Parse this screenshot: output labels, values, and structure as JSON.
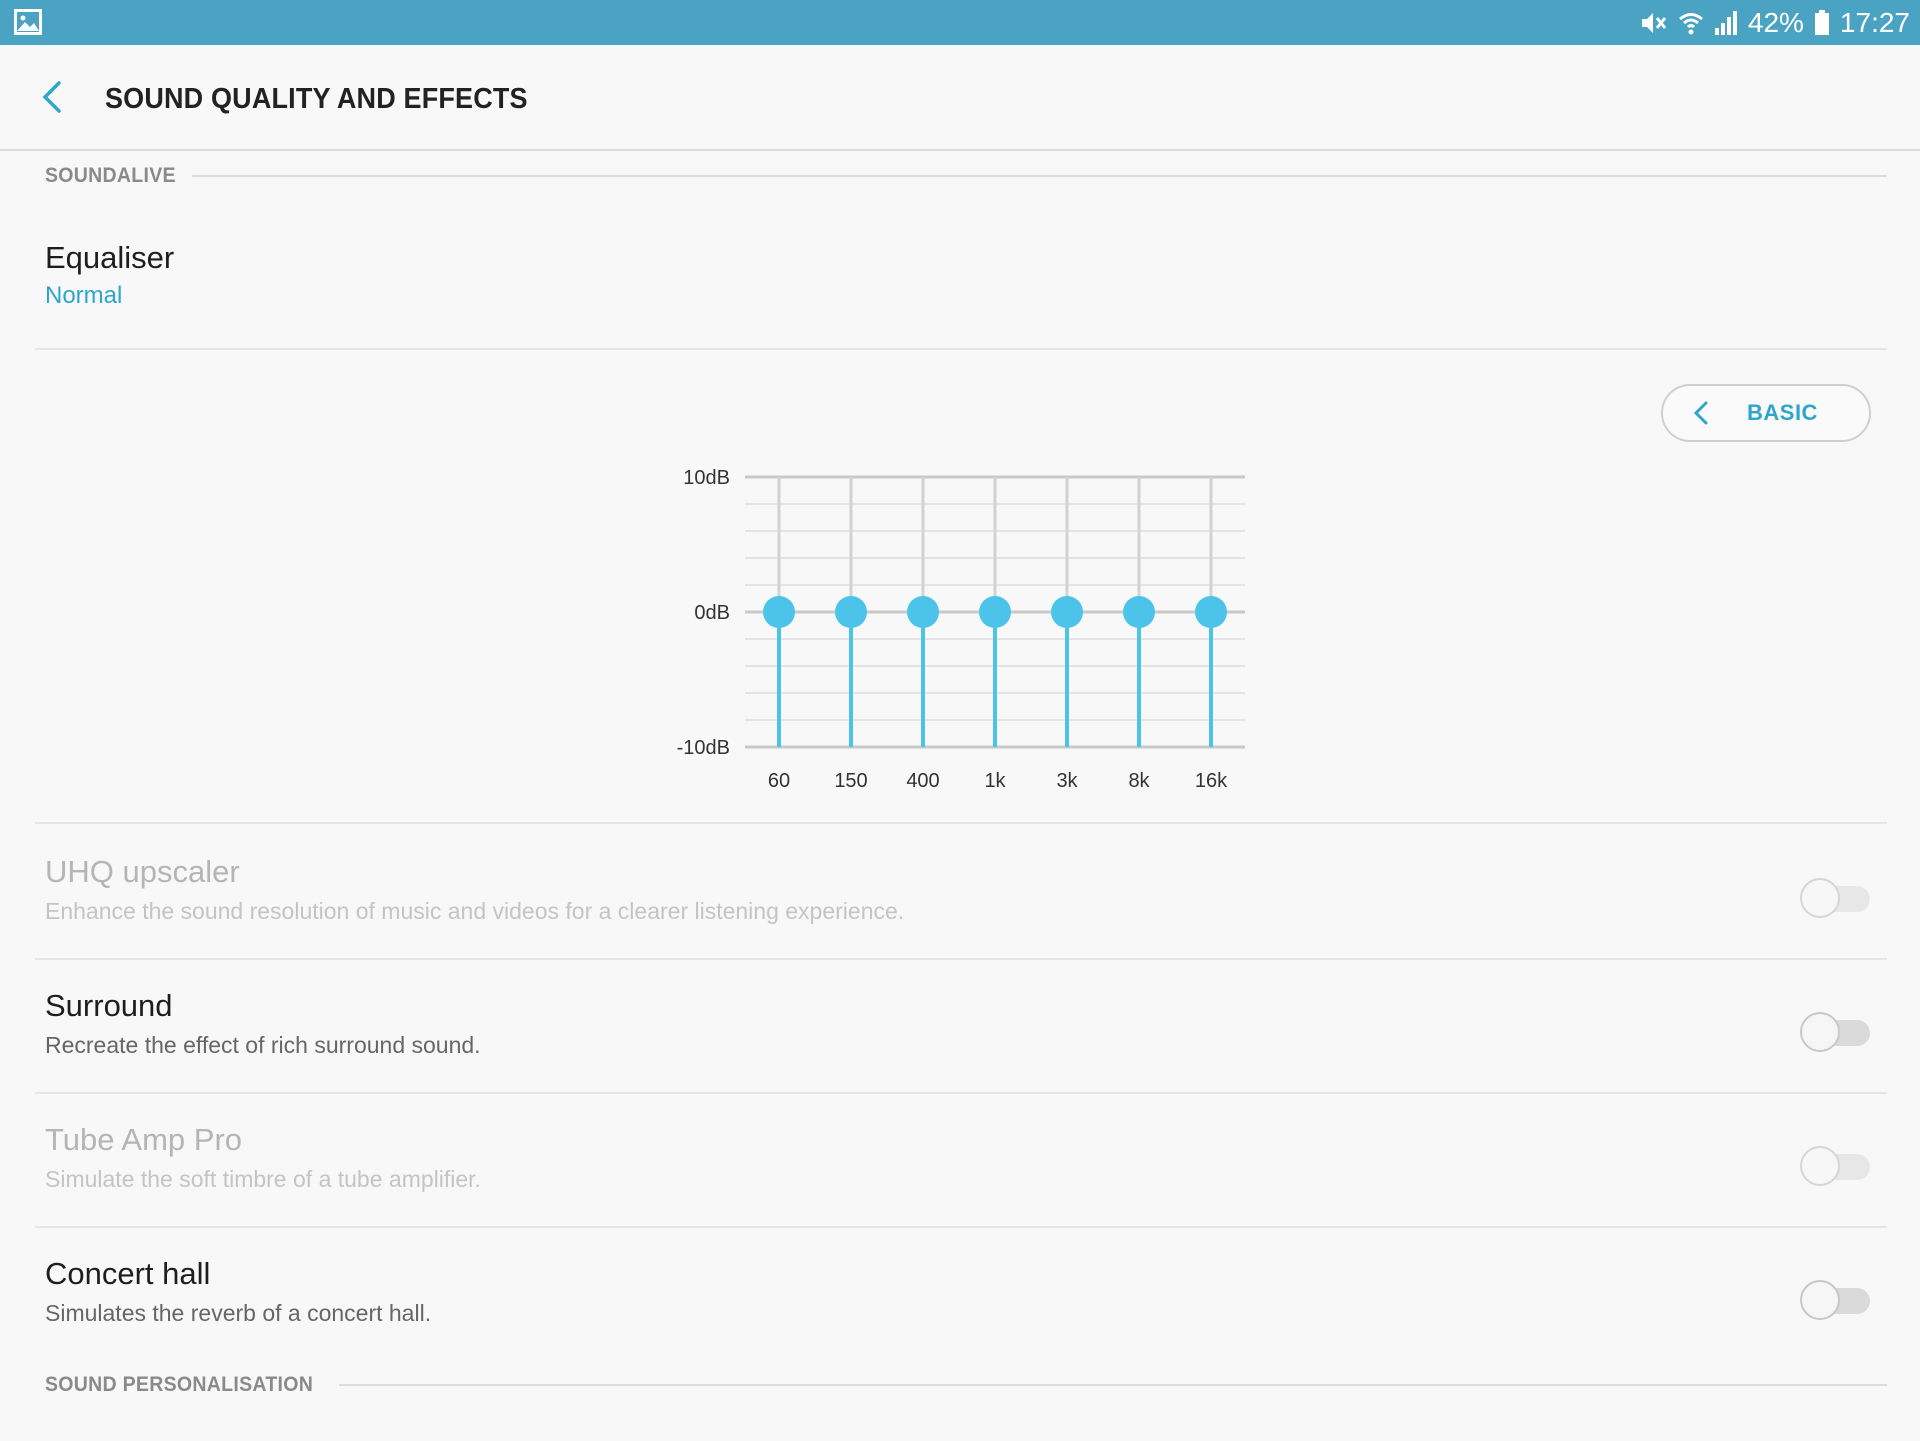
{
  "status_bar": {
    "battery": "42%",
    "time": "17:27",
    "icons": [
      "gallery-icon",
      "mute-icon",
      "wifi-icon",
      "signal-icon",
      "battery-icon"
    ]
  },
  "header": {
    "title": "SOUND QUALITY AND EFFECTS",
    "back_icon": "chevron-left-icon"
  },
  "sections": {
    "soundalive": "SOUNDALIVE",
    "personalisation": "SOUND PERSONALISATION"
  },
  "equaliser": {
    "title": "Equaliser",
    "value": "Normal"
  },
  "eq_panel": {
    "basic_label": "BASIC",
    "y_labels": [
      "10dB",
      "0dB",
      "-10dB"
    ],
    "bands": [
      {
        "freq": "60",
        "gain_db": 0
      },
      {
        "freq": "150",
        "gain_db": 0
      },
      {
        "freq": "400",
        "gain_db": 0
      },
      {
        "freq": "1k",
        "gain_db": 0
      },
      {
        "freq": "3k",
        "gain_db": 0
      },
      {
        "freq": "8k",
        "gain_db": 0
      },
      {
        "freq": "16k",
        "gain_db": 0
      }
    ],
    "accent_color": "#4cc3e8"
  },
  "toggles": [
    {
      "title": "UHQ upscaler",
      "desc": "Enhance the sound resolution of music and videos for a clearer listening experience.",
      "enabled": false,
      "on": false
    },
    {
      "title": "Surround",
      "desc": "Recreate the effect of rich surround sound.",
      "enabled": true,
      "on": false
    },
    {
      "title": "Tube Amp Pro",
      "desc": "Simulate the soft timbre of a tube amplifier.",
      "enabled": false,
      "on": false
    },
    {
      "title": "Concert hall",
      "desc": "Simulates the reverb of a concert hall.",
      "enabled": true,
      "on": false
    }
  ]
}
